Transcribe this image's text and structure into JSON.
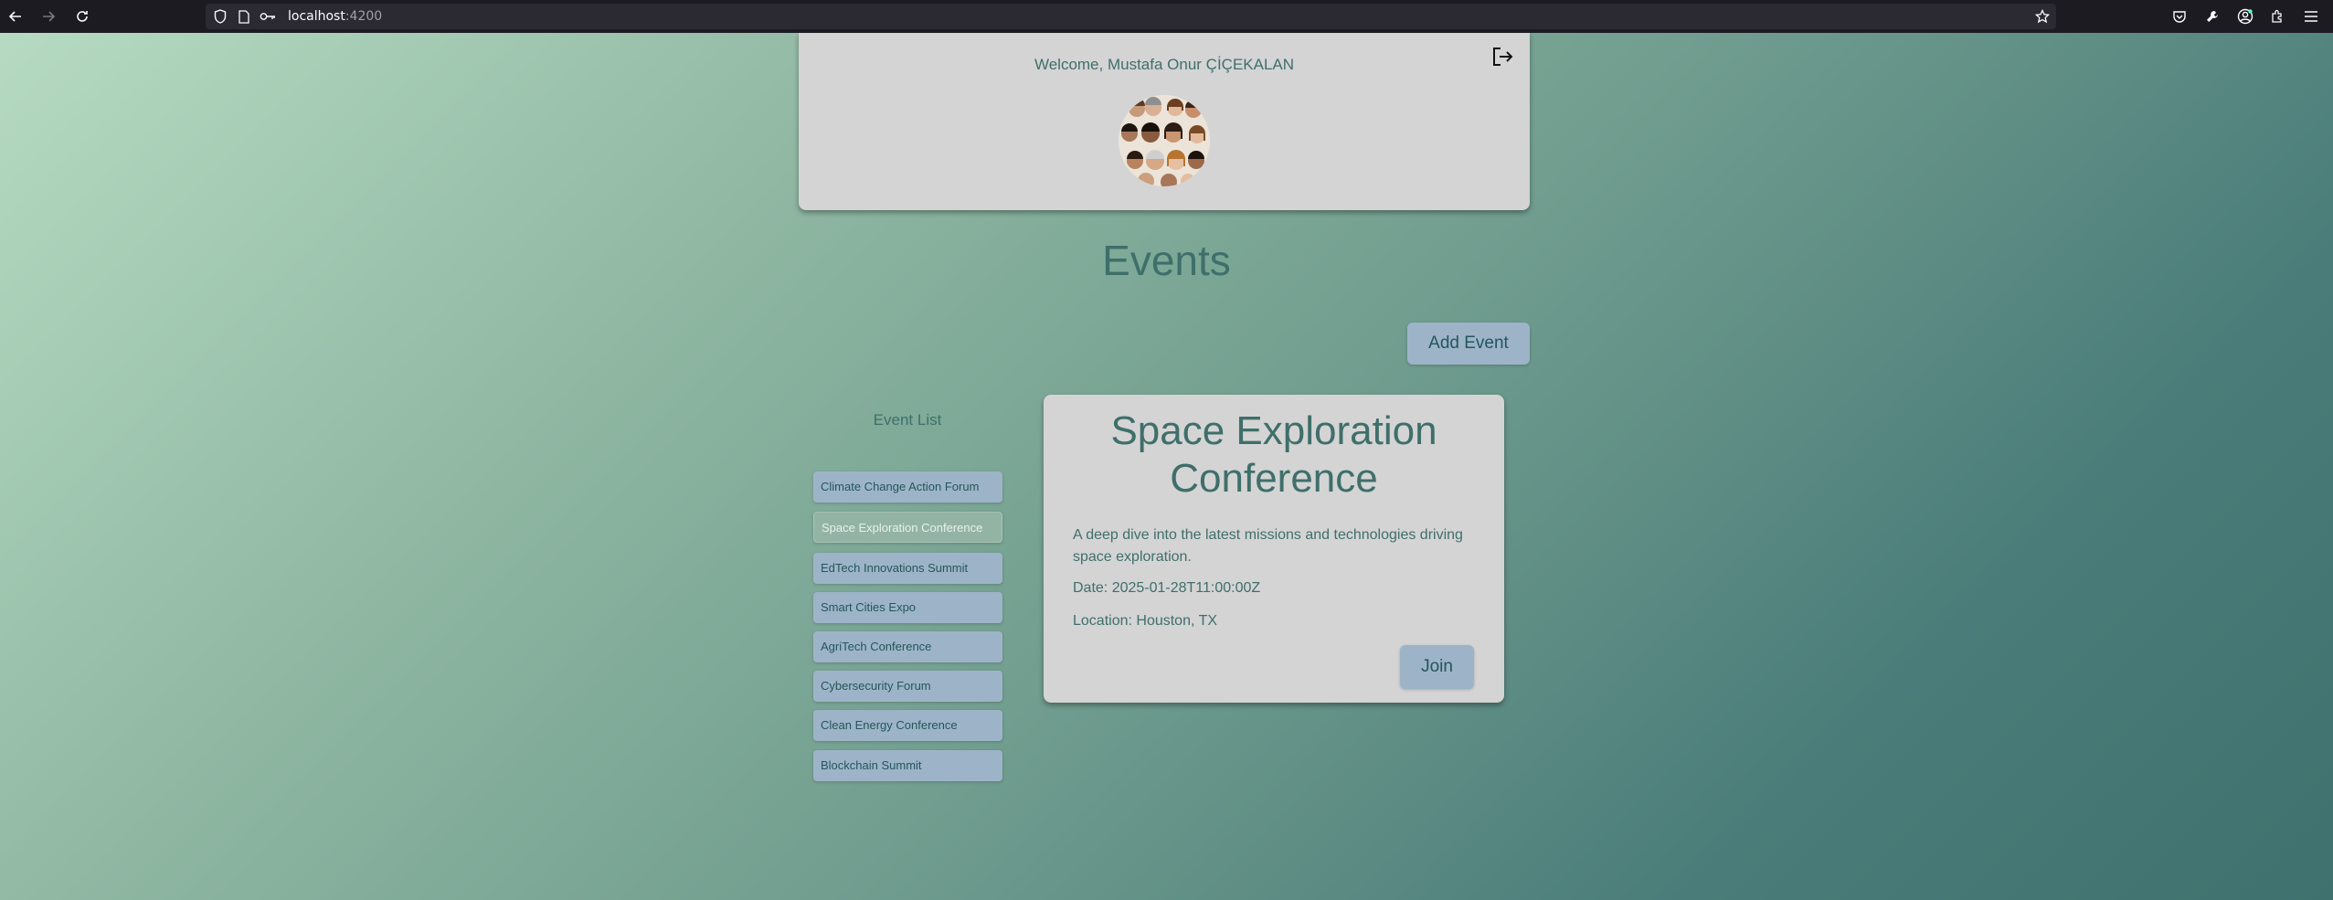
{
  "browser": {
    "url_host": "localhost",
    "url_port": ":4200"
  },
  "header": {
    "welcome": "Welcome, Mustafa Onur ÇİÇEKALAN"
  },
  "page": {
    "title": "Events",
    "add_event_label": "Add Event"
  },
  "event_list": {
    "title": "Event List",
    "items": [
      {
        "label": "Climate Change Action Forum"
      },
      {
        "label": "Space Exploration Conference"
      },
      {
        "label": "EdTech Innovations Summit"
      },
      {
        "label": "Smart Cities Expo"
      },
      {
        "label": "AgriTech Conference"
      },
      {
        "label": "Cybersecurity Forum"
      },
      {
        "label": "Clean Energy Conference"
      },
      {
        "label": "Blockchain Summit"
      }
    ],
    "selected": "Space Exploration Conference"
  },
  "event_detail": {
    "title": "Space Exploration Conference",
    "description": "A deep dive into the latest missions and technologies driving space exploration.",
    "date": "Date: 2025-01-28T11:00:00Z",
    "location": "Location: Houston, TX",
    "join_label": "Join"
  },
  "colors": {
    "accent": "#3f6f6a",
    "button": "#9db4c8",
    "card": "#d4d4d4"
  }
}
